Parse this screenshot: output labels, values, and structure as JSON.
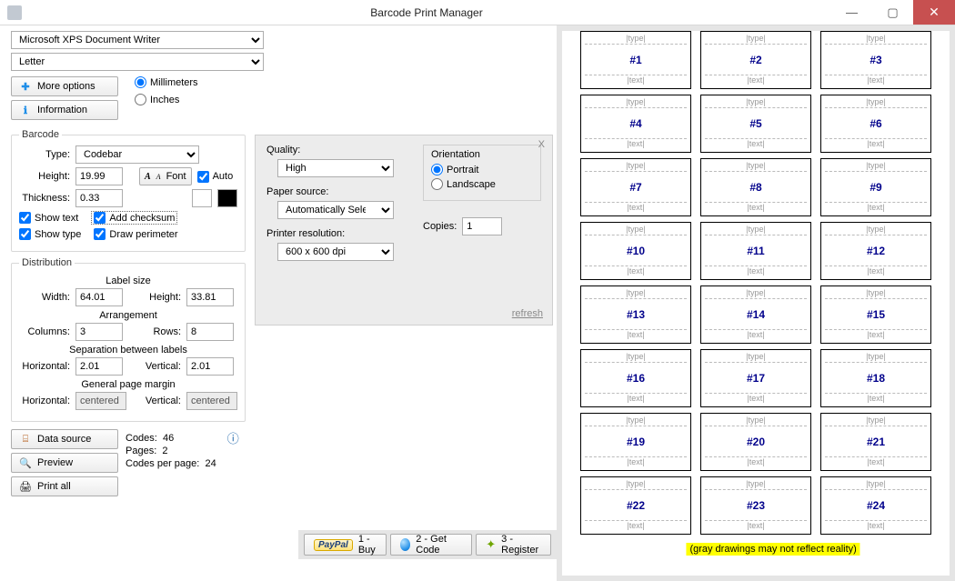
{
  "window": {
    "title": "Barcode Print Manager"
  },
  "top": {
    "printer": "Microsoft XPS Document Writer",
    "paper": "Letter",
    "more_options": "More options",
    "information": "Information",
    "unit_mm": "Millimeters",
    "unit_in": "Inches"
  },
  "barcode": {
    "legend": "Barcode",
    "type_label": "Type:",
    "type_value": "Codebar",
    "height_label": "Height:",
    "height_value": "19.99",
    "font_label": "Font",
    "auto_label": "Auto",
    "thickness_label": "Thickness:",
    "thickness_value": "0.33",
    "show_text": "Show text",
    "add_checksum": "Add checksum",
    "show_type": "Show type",
    "draw_perimeter": "Draw perimeter"
  },
  "distribution": {
    "legend": "Distribution",
    "label_size_heading": "Label size",
    "width_label": "Width:",
    "width_value": "64.01",
    "height_label": "Height:",
    "height_value": "33.81",
    "arrangement_heading": "Arrangement",
    "columns_label": "Columns:",
    "columns_value": "3",
    "rows_label": "Rows:",
    "rows_value": "8",
    "separation_heading": "Separation between labels",
    "horiz_label": "Horizontal:",
    "horiz_value": "2.01",
    "vert_label": "Vertical:",
    "vert_value": "2.01",
    "margin_heading": "General page margin",
    "margin_horiz_value": "centered",
    "margin_vert_value": "centered"
  },
  "bottom": {
    "data_source": "Data source",
    "preview": "Preview",
    "print_all": "Print all",
    "codes_label": "Codes:",
    "codes_value": "46",
    "pages_label": "Pages:",
    "pages_value": "2",
    "cpp_label": "Codes per page:",
    "cpp_value": "24"
  },
  "quality": {
    "quality_label": "Quality:",
    "quality_value": "High",
    "paper_source_label": "Paper source:",
    "paper_source_value": "Automatically Select",
    "resolution_label": "Printer resolution:",
    "resolution_value": "600 x 600 dpi",
    "orientation_label": "Orientation",
    "portrait": "Portrait",
    "landscape": "Landscape",
    "copies_label": "Copies:",
    "copies_value": "1",
    "refresh": "refresh",
    "close_x": "X"
  },
  "reg_toolbar": {
    "buy": "1 - Buy",
    "getcode": "2 - Get Code",
    "register": "3 - Register"
  },
  "preview": {
    "type_ph": "|type|",
    "text_ph": "|text|",
    "banner": "(gray drawings may not reflect reality)",
    "labels": [
      "#1",
      "#2",
      "#3",
      "#4",
      "#5",
      "#6",
      "#7",
      "#8",
      "#9",
      "#10",
      "#11",
      "#12",
      "#13",
      "#14",
      "#15",
      "#16",
      "#17",
      "#18",
      "#19",
      "#20",
      "#21",
      "#22",
      "#23",
      "#24"
    ]
  }
}
